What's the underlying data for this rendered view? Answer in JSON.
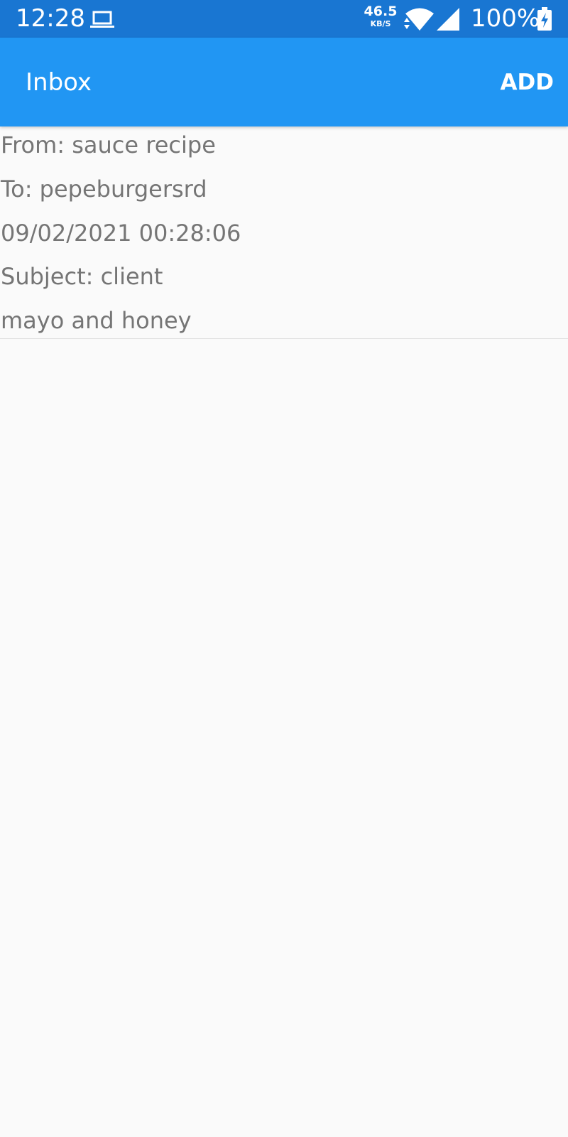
{
  "status_bar": {
    "time": "12:28",
    "notification_icon": "laptop-icon",
    "network_speed": "46.5",
    "network_speed_unit": "KB/S",
    "battery_percent": "100%",
    "icons": [
      "laptop-icon",
      "data-arrows-icon",
      "wifi-icon",
      "signal-icon",
      "battery-charging-icon"
    ],
    "background_color": "#1976d2"
  },
  "app_bar": {
    "title": "Inbox",
    "add_label": "ADD",
    "background_color": "#2196f3"
  },
  "messages": [
    {
      "from": "From: sauce recipe",
      "to": "To: pepeburgersrd",
      "date": "09/02/2021 00:28:06",
      "subject": "Subject: client",
      "body": "mayo and honey"
    }
  ],
  "colors": {
    "page_background": "#fafafa",
    "message_text": "#757575",
    "divider": "#e0e0e0"
  }
}
